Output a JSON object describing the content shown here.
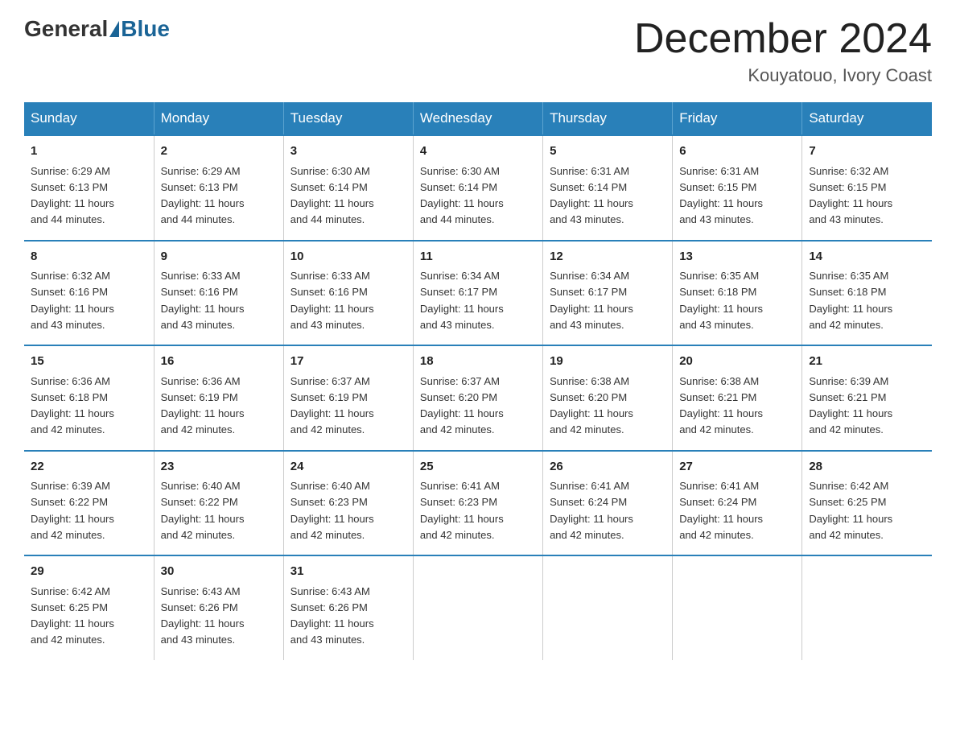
{
  "header": {
    "logo_general": "General",
    "logo_blue": "Blue",
    "month_title": "December 2024",
    "location": "Kouyatouo, Ivory Coast"
  },
  "days_of_week": [
    "Sunday",
    "Monday",
    "Tuesday",
    "Wednesday",
    "Thursday",
    "Friday",
    "Saturday"
  ],
  "weeks": [
    [
      {
        "day": "1",
        "sunrise": "6:29 AM",
        "sunset": "6:13 PM",
        "daylight": "11 hours and 44 minutes."
      },
      {
        "day": "2",
        "sunrise": "6:29 AM",
        "sunset": "6:13 PM",
        "daylight": "11 hours and 44 minutes."
      },
      {
        "day": "3",
        "sunrise": "6:30 AM",
        "sunset": "6:14 PM",
        "daylight": "11 hours and 44 minutes."
      },
      {
        "day": "4",
        "sunrise": "6:30 AM",
        "sunset": "6:14 PM",
        "daylight": "11 hours and 44 minutes."
      },
      {
        "day": "5",
        "sunrise": "6:31 AM",
        "sunset": "6:14 PM",
        "daylight": "11 hours and 43 minutes."
      },
      {
        "day": "6",
        "sunrise": "6:31 AM",
        "sunset": "6:15 PM",
        "daylight": "11 hours and 43 minutes."
      },
      {
        "day": "7",
        "sunrise": "6:32 AM",
        "sunset": "6:15 PM",
        "daylight": "11 hours and 43 minutes."
      }
    ],
    [
      {
        "day": "8",
        "sunrise": "6:32 AM",
        "sunset": "6:16 PM",
        "daylight": "11 hours and 43 minutes."
      },
      {
        "day": "9",
        "sunrise": "6:33 AM",
        "sunset": "6:16 PM",
        "daylight": "11 hours and 43 minutes."
      },
      {
        "day": "10",
        "sunrise": "6:33 AM",
        "sunset": "6:16 PM",
        "daylight": "11 hours and 43 minutes."
      },
      {
        "day": "11",
        "sunrise": "6:34 AM",
        "sunset": "6:17 PM",
        "daylight": "11 hours and 43 minutes."
      },
      {
        "day": "12",
        "sunrise": "6:34 AM",
        "sunset": "6:17 PM",
        "daylight": "11 hours and 43 minutes."
      },
      {
        "day": "13",
        "sunrise": "6:35 AM",
        "sunset": "6:18 PM",
        "daylight": "11 hours and 43 minutes."
      },
      {
        "day": "14",
        "sunrise": "6:35 AM",
        "sunset": "6:18 PM",
        "daylight": "11 hours and 42 minutes."
      }
    ],
    [
      {
        "day": "15",
        "sunrise": "6:36 AM",
        "sunset": "6:18 PM",
        "daylight": "11 hours and 42 minutes."
      },
      {
        "day": "16",
        "sunrise": "6:36 AM",
        "sunset": "6:19 PM",
        "daylight": "11 hours and 42 minutes."
      },
      {
        "day": "17",
        "sunrise": "6:37 AM",
        "sunset": "6:19 PM",
        "daylight": "11 hours and 42 minutes."
      },
      {
        "day": "18",
        "sunrise": "6:37 AM",
        "sunset": "6:20 PM",
        "daylight": "11 hours and 42 minutes."
      },
      {
        "day": "19",
        "sunrise": "6:38 AM",
        "sunset": "6:20 PM",
        "daylight": "11 hours and 42 minutes."
      },
      {
        "day": "20",
        "sunrise": "6:38 AM",
        "sunset": "6:21 PM",
        "daylight": "11 hours and 42 minutes."
      },
      {
        "day": "21",
        "sunrise": "6:39 AM",
        "sunset": "6:21 PM",
        "daylight": "11 hours and 42 minutes."
      }
    ],
    [
      {
        "day": "22",
        "sunrise": "6:39 AM",
        "sunset": "6:22 PM",
        "daylight": "11 hours and 42 minutes."
      },
      {
        "day": "23",
        "sunrise": "6:40 AM",
        "sunset": "6:22 PM",
        "daylight": "11 hours and 42 minutes."
      },
      {
        "day": "24",
        "sunrise": "6:40 AM",
        "sunset": "6:23 PM",
        "daylight": "11 hours and 42 minutes."
      },
      {
        "day": "25",
        "sunrise": "6:41 AM",
        "sunset": "6:23 PM",
        "daylight": "11 hours and 42 minutes."
      },
      {
        "day": "26",
        "sunrise": "6:41 AM",
        "sunset": "6:24 PM",
        "daylight": "11 hours and 42 minutes."
      },
      {
        "day": "27",
        "sunrise": "6:41 AM",
        "sunset": "6:24 PM",
        "daylight": "11 hours and 42 minutes."
      },
      {
        "day": "28",
        "sunrise": "6:42 AM",
        "sunset": "6:25 PM",
        "daylight": "11 hours and 42 minutes."
      }
    ],
    [
      {
        "day": "29",
        "sunrise": "6:42 AM",
        "sunset": "6:25 PM",
        "daylight": "11 hours and 42 minutes."
      },
      {
        "day": "30",
        "sunrise": "6:43 AM",
        "sunset": "6:26 PM",
        "daylight": "11 hours and 43 minutes."
      },
      {
        "day": "31",
        "sunrise": "6:43 AM",
        "sunset": "6:26 PM",
        "daylight": "11 hours and 43 minutes."
      },
      null,
      null,
      null,
      null
    ]
  ],
  "labels": {
    "sunrise": "Sunrise:",
    "sunset": "Sunset:",
    "daylight": "Daylight:"
  }
}
